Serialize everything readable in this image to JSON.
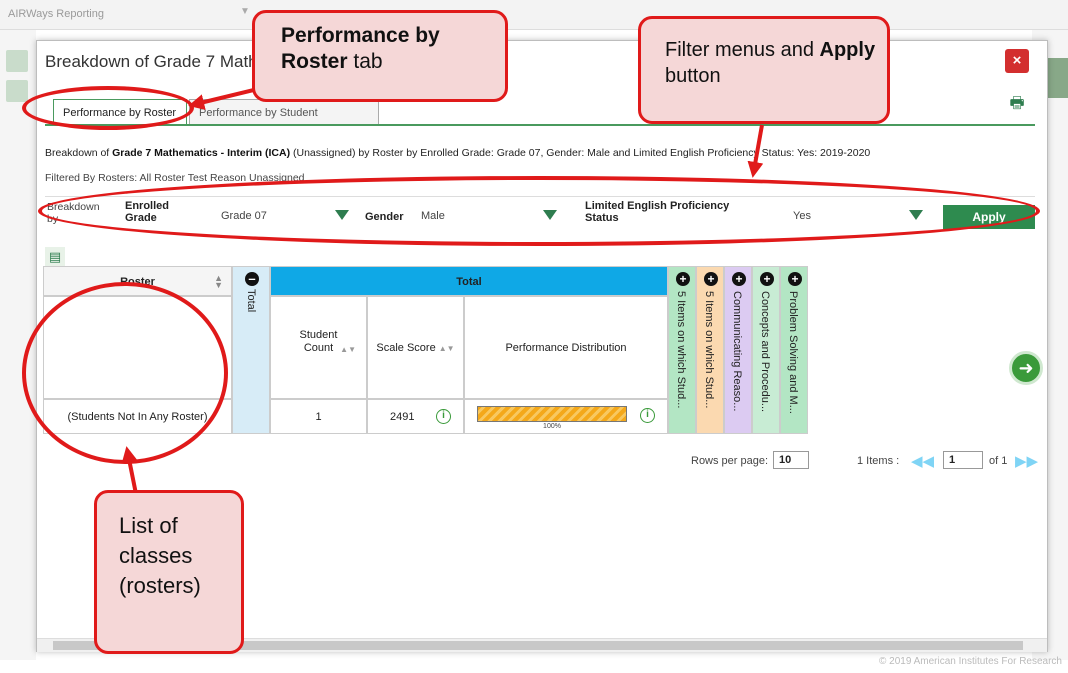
{
  "background": {
    "app_title": "AIRWays Reporting",
    "copyright": "© 2019 American Institutes For Research"
  },
  "modal": {
    "title": "Breakdown of Grade 7 Mathematics - Interim (ICA)",
    "close_label": "×",
    "tabs": [
      {
        "label": "Performance by Roster",
        "active": true
      },
      {
        "label": "Performance by Student",
        "active": false
      }
    ],
    "breadcrumb": {
      "prefix": "Breakdown of ",
      "test": "Grade 7 Mathematics - Interim (ICA)",
      "rest": " (Unassigned) by Roster by Enrolled Grade: Grade 07, Gender: Male and Limited English Proficiency Status: Yes: 2019-2020"
    },
    "filtered_by": "Filtered By Rosters: All Roster Test Reason Unassigned",
    "filters": {
      "breakdown_by_label": "Breakdown by",
      "enrolled_grade_label": "Enrolled Grade",
      "enrolled_grade_value": "Grade 07",
      "gender_label": "Gender",
      "gender_value": "Male",
      "lep_label": "Limited English Proficiency Status",
      "lep_value": "Yes",
      "apply_label": "Apply"
    },
    "table": {
      "roster_header": "Roster",
      "total_vertical": "Total",
      "total_band": "Total",
      "student_count_header": "Student Count",
      "scale_score_header": "Scale Score",
      "perf_dist_header": "Performance Distribution",
      "claims": [
        {
          "label": "5 Items on which Stud...",
          "color": "#b3e6c4"
        },
        {
          "label": "5 Items on which Stud...",
          "color": "#fbd9b0"
        },
        {
          "label": "Communicating Reaso...",
          "color": "#dccbf2"
        },
        {
          "label": "Concepts and Procedu...",
          "color": "#c8ecd4"
        },
        {
          "label": "Problem Solving and M...",
          "color": "#b3e6c4"
        }
      ],
      "rows": [
        {
          "roster": "(Students Not In Any Roster)",
          "student_count": "1",
          "scale_score": "2491",
          "perf_label": "100%",
          "perf_fraction": 1.0
        }
      ]
    },
    "pagination": {
      "rows_per_page_label": "Rows per page:",
      "rows_per_page_value": "10",
      "items_label": "1 Items :",
      "page_value": "1",
      "of_label": "of 1"
    }
  },
  "callouts": {
    "roster_tab": {
      "bold": "Performance by Roster",
      "normal": " tab"
    },
    "filters": {
      "normal": "Filter menus and ",
      "bold": "Apply",
      "normal2": " button"
    },
    "classes": "List of classes (rosters)"
  },
  "colors": {
    "accent": "#e01a1a",
    "total_band": "#0fa8e6",
    "apply_button": "#2e8b4f"
  }
}
